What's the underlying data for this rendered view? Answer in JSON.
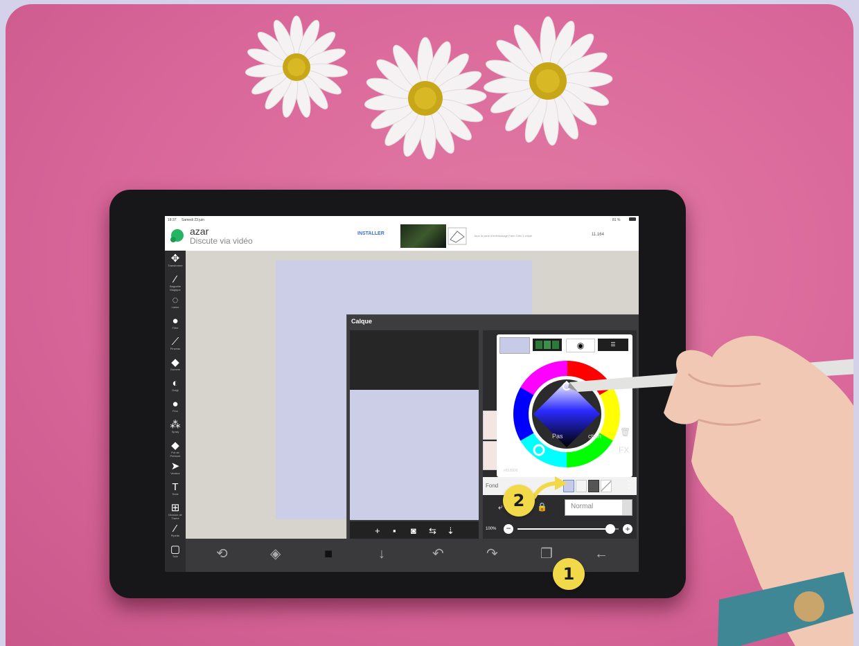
{
  "statusbar": {
    "time": "18:37",
    "date": "Samedi 23 juin",
    "battery": "81 %"
  },
  "ad": {
    "app_name": "azar",
    "tagline": "Discute via vidéo",
    "install_label": "INSTALLER",
    "description": "Joue la carte d'embrassage Farm Cam 3 chiper",
    "count": "11,164"
  },
  "left_tools": [
    {
      "icon": "move-icon",
      "glyph": "✥",
      "label": "Transformer"
    },
    {
      "icon": "magic-wand-icon",
      "glyph": "⁄",
      "label": "Baguette Magique"
    },
    {
      "icon": "lasso-icon",
      "glyph": "◌",
      "label": "Lasso"
    },
    {
      "icon": "filter-icon",
      "glyph": "●",
      "label": "Filtre"
    },
    {
      "icon": "brush-icon",
      "glyph": "⟋",
      "label": "Pinceau"
    },
    {
      "icon": "eraser-icon",
      "glyph": "◆",
      "label": "Gomme"
    },
    {
      "icon": "smudge-icon",
      "glyph": "◐",
      "label": "Doigt"
    },
    {
      "icon": "blur-icon",
      "glyph": "●",
      "label": "Flou"
    },
    {
      "icon": "spray-icon",
      "glyph": "⁂",
      "label": "Spray"
    },
    {
      "icon": "fill-icon",
      "glyph": "◆",
      "label": "Pot de Peinture"
    },
    {
      "icon": "select-icon",
      "glyph": "➤",
      "label": "Vecteur"
    },
    {
      "icon": "text-icon",
      "glyph": "T",
      "label": "Texte"
    },
    {
      "icon": "frame-icon",
      "glyph": "⊞",
      "label": "Division de Trame"
    },
    {
      "icon": "eyedropper-icon",
      "glyph": "⁄",
      "label": "Pipette"
    },
    {
      "icon": "canvas-icon",
      "glyph": "▢",
      "label": "Toile"
    }
  ],
  "layer_panel": {
    "title": "Calque",
    "hex": "#6535D0",
    "fond_label": "Fond",
    "blend_mode": "Normal",
    "opacity": "100%",
    "opacity_value": 0.92,
    "fx_label": "FX",
    "pas_label": "Pas",
    "action_label": "ction"
  },
  "thumb_tools": [
    {
      "icon": "add-layer-icon",
      "glyph": "+"
    },
    {
      "icon": "layer-square-icon",
      "glyph": "▪"
    },
    {
      "icon": "camera-icon",
      "glyph": "◙"
    },
    {
      "icon": "import-icon",
      "glyph": "⇆"
    },
    {
      "icon": "text-layer-icon",
      "glyph": "⇣"
    }
  ],
  "bottom_bar": [
    {
      "icon": "rotate-icon",
      "glyph": "⟲"
    },
    {
      "icon": "compass-icon",
      "glyph": "◈"
    },
    {
      "icon": "color-swatch-icon",
      "glyph": "■"
    },
    {
      "icon": "download-icon",
      "glyph": "↓"
    },
    {
      "icon": "undo-icon",
      "glyph": "↶"
    },
    {
      "icon": "redo-icon",
      "glyph": "↷"
    },
    {
      "icon": "layers-icon",
      "glyph": "❐"
    },
    {
      "icon": "back-icon",
      "glyph": "←"
    }
  ],
  "badges": {
    "one": "1",
    "two": "2"
  },
  "colors": {
    "accent_yellow": "#f2d94a",
    "background_pink": "#d9679a",
    "canvas_lavender": "#cccde6"
  }
}
